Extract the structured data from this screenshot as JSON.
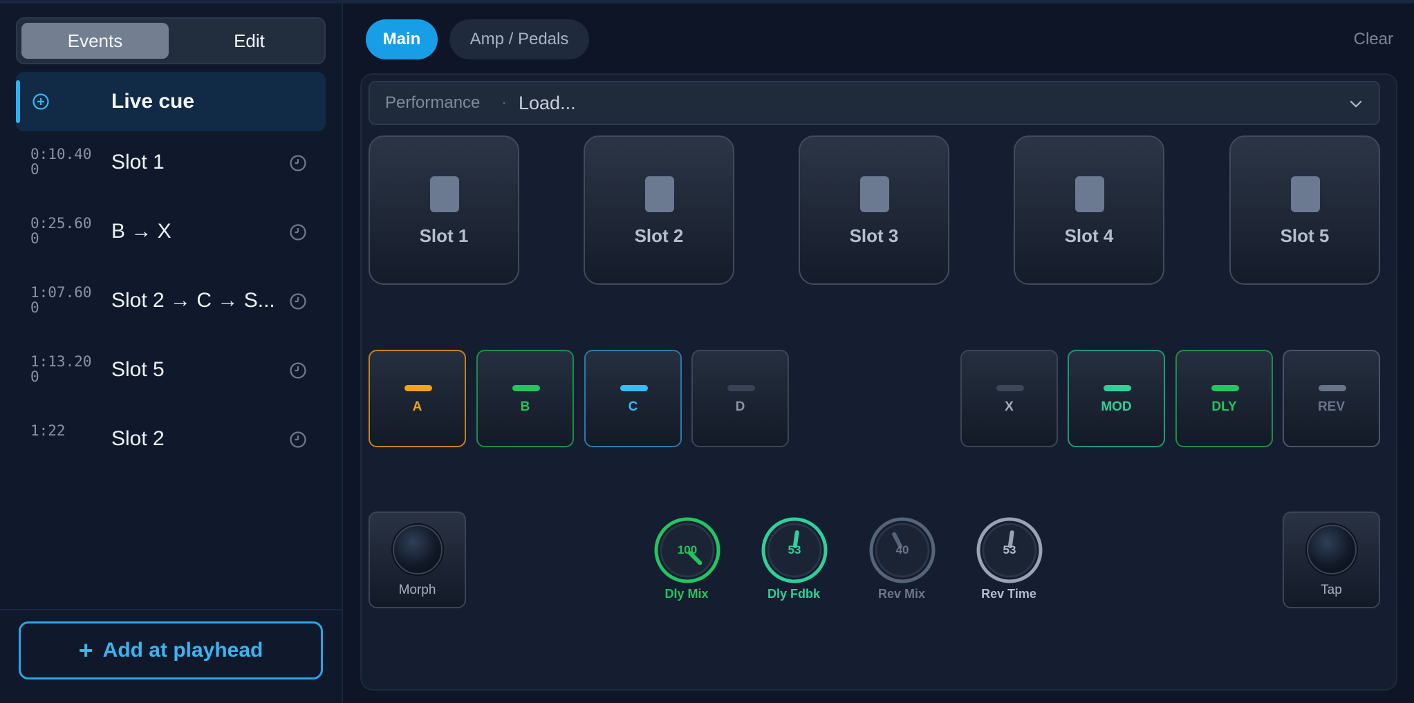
{
  "tabs_left": {
    "events": "Events",
    "edit": "Edit"
  },
  "live_cue": {
    "label": "Live cue",
    "icon": "plus-circle-icon"
  },
  "events": [
    {
      "time": "0:10.400",
      "name": "Slot 1"
    },
    {
      "time": "0:25.600",
      "name": "B → X"
    },
    {
      "time": "1:07.600",
      "name": "Slot 2 → C → S..."
    },
    {
      "time": "1:13.200",
      "name": "Slot 5"
    },
    {
      "time": "1:22",
      "name": "Slot 2"
    }
  ],
  "add_button": {
    "plus": "+",
    "label": "Add at playhead"
  },
  "tabs_right": {
    "main": "Main",
    "amp": "Amp / Pedals",
    "clear": "Clear"
  },
  "performance": {
    "label": "Performance",
    "separator": "·",
    "value": "Load..."
  },
  "slots": [
    {
      "label": "Slot 1"
    },
    {
      "label": "Slot 2"
    },
    {
      "label": "Slot 3"
    },
    {
      "label": "Slot 4"
    },
    {
      "label": "Slot 5"
    }
  ],
  "scenes": [
    {
      "label": "A",
      "color": "#f2a31b",
      "border": "#c7831a",
      "text": "#f2a31b"
    },
    {
      "label": "B",
      "color": "#22c55e",
      "border": "#1f8c4a",
      "text": "#22c55e"
    },
    {
      "label": "C",
      "color": "#38bdf8",
      "border": "#2a7aa8",
      "text": "#38bdf8"
    },
    {
      "label": "D",
      "color": "#374355",
      "border": "#3a4556",
      "text": "#8d97a6"
    }
  ],
  "effects": [
    {
      "label": "X",
      "color": "#3c4759",
      "border": "#3a4556",
      "text": "#a6afbc"
    },
    {
      "label": "MOD",
      "color": "#2fd19a",
      "border": "#1f9a6e",
      "text": "#2fd19a"
    },
    {
      "label": "DLY",
      "color": "#22c55e",
      "border": "#1f8c4a",
      "text": "#22c55e"
    },
    {
      "label": "REV",
      "color": "#67748a",
      "border": "#4a5567",
      "text": "#67748a"
    }
  ],
  "footswitches": {
    "left": "Morph",
    "right": "Tap"
  },
  "knobs": [
    {
      "label": "Dly Mix",
      "value": "100",
      "level": 100,
      "ring": "#22c55e",
      "text": "#22c55e"
    },
    {
      "label": "Dly Fdbk",
      "value": "53",
      "level": 53,
      "ring": "#2fd19a",
      "text": "#2fd19a"
    },
    {
      "label": "Rev Mix",
      "value": "40",
      "level": 40,
      "ring": "#56647a",
      "text": "#6b778a"
    },
    {
      "label": "Rev Time",
      "value": "53",
      "level": 53,
      "ring": "#98a3b3",
      "text": "#b4bdc9"
    }
  ]
}
